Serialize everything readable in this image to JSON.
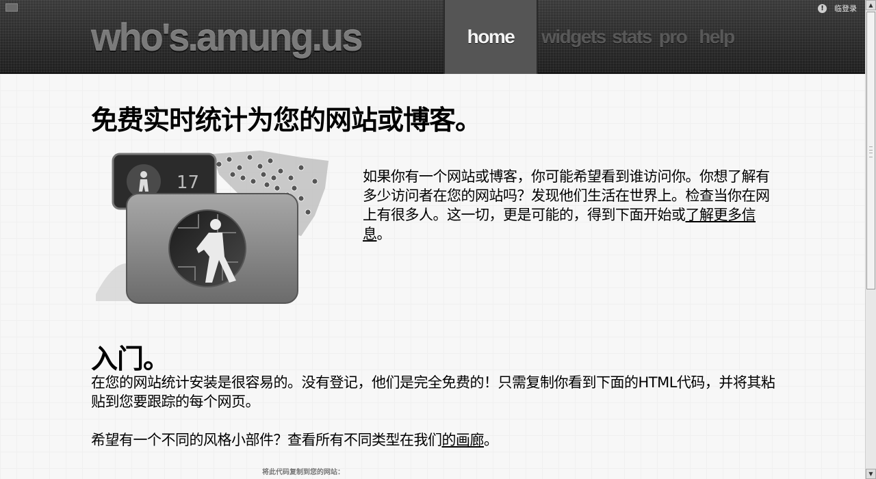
{
  "header": {
    "logo_text": "who's.amung.us",
    "nav": [
      {
        "label": "home",
        "active": true
      },
      {
        "label": "widgets"
      },
      {
        "label": "stats"
      },
      {
        "label": "pro"
      },
      {
        "label": "help"
      }
    ],
    "login_label": "临登录"
  },
  "main": {
    "headline": "免费实时统计为您的网站或博客。",
    "intro_text": "如果你有一个网站或博客，你可能希望看到谁访问你。你想了解有多少访问者在您的网站吗？发现他们生活在世界上。检查当你在网上有很多人。这一切，更是可能的，得到下面开始或",
    "intro_link": "了解更多信息",
    "intro_end": "。",
    "hero_counter": "17",
    "section_title": "入门。",
    "install_text": "在您的网站统计安装是很容易的。没有登记，他们是完全免费的！只需复制你看到下面的HTML代码，并将其粘贴到您要跟踪的每个网页。",
    "widgets_text": "希望有一个不同的风格小部件？查看所有不同类型在我们",
    "widgets_link": "的画廊",
    "widgets_end": "。",
    "copy_label": "将此代码复制到您的网站："
  },
  "colors": {
    "header_bg": "#2a2a2a",
    "nav_active_bg": "#555555",
    "nav_inactive_text": "#585858",
    "page_bg": "#f7f7f7"
  }
}
